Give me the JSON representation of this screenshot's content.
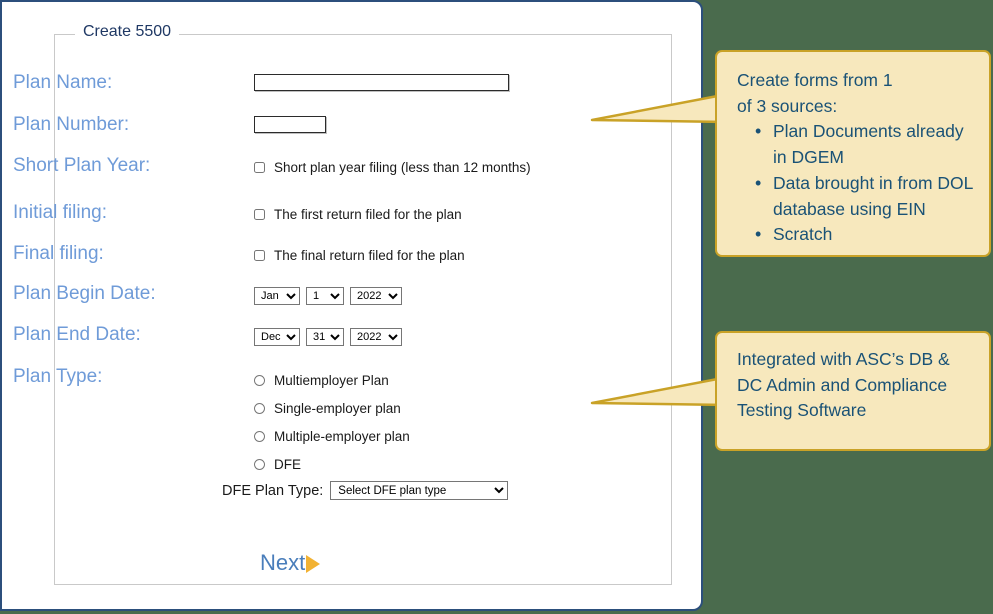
{
  "window": {
    "background_color": "#4a6b4d",
    "panel_background": "#ffffff",
    "panel_border_color": "#2c4f7c"
  },
  "form": {
    "legend": "Create 5500",
    "label_color": "#6f9bd8",
    "rows": [
      {
        "label": "Plan Name:",
        "type": "text",
        "value": ""
      },
      {
        "label": "Plan Number:",
        "type": "text",
        "value": ""
      },
      {
        "label": "Short Plan Year:",
        "type": "checkbox",
        "checkbox_text": "Short plan year filing (less than 12 months)",
        "checked": false
      },
      {
        "label": "Initial filing:",
        "type": "checkbox",
        "checkbox_text": "The first return filed for the plan",
        "checked": false
      },
      {
        "label": "Final filing:",
        "type": "checkbox",
        "checkbox_text": "The final return filed for the plan",
        "checked": false
      },
      {
        "label": "Plan Begin Date:",
        "type": "date",
        "month": "Jan",
        "day": "1",
        "year": "2022"
      },
      {
        "label": "Plan End Date:",
        "type": "date",
        "month": "Dec",
        "day": "31",
        "year": "2022"
      },
      {
        "label": "Plan Type:",
        "type": "radio"
      }
    ],
    "plan_type_options": [
      "Multiemployer Plan",
      "Single-employer plan",
      "Multiple-employer plan",
      "DFE"
    ],
    "plan_type_selected": "",
    "dfe": {
      "label": "DFE Plan Type:",
      "selected": "Select DFE plan type"
    },
    "next_button": {
      "label": "Next",
      "arrow_icon": "play-triangle-icon",
      "text_color": "#4a7ebb",
      "arrow_color": "#f2b233"
    }
  },
  "callouts": [
    {
      "id": "sources",
      "lead": "Create forms from 1\nof 3 sources:",
      "bullets": [
        "Plan Documents already in DGEM",
        "Data brought in from DOL database using EIN",
        "Scratch"
      ],
      "fill_color": "#f7e8bd",
      "border_color": "#c9a227",
      "text_color": "#1a5276"
    },
    {
      "id": "integration",
      "lead": "Integrated with ASC’s  DB & DC Admin and Compliance Testing Software",
      "bullets": [],
      "fill_color": "#f7e8bd",
      "border_color": "#c9a227",
      "text_color": "#1a5276"
    }
  ]
}
